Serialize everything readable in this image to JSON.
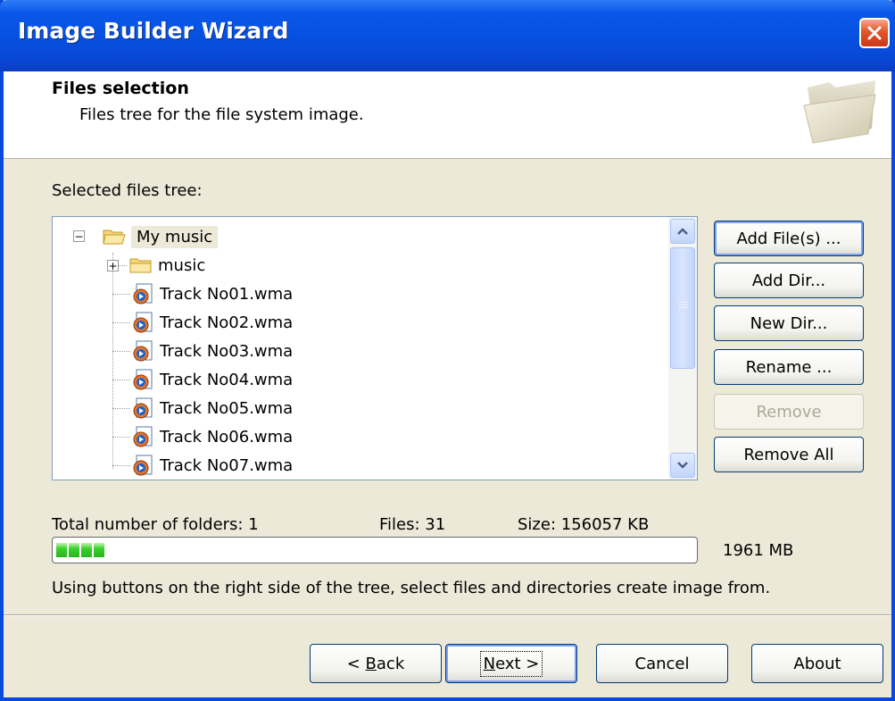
{
  "window": {
    "title": "Image Builder Wizard",
    "close_icon": "close-icon"
  },
  "header": {
    "title": "Files selection",
    "subtitle": "Files tree for the file system image.",
    "icon": "folder-icon"
  },
  "tree": {
    "label": "Selected files tree:",
    "root": {
      "name": "My music",
      "expanded": true
    },
    "items": [
      {
        "name": "music",
        "type": "folder",
        "expanded": false
      },
      {
        "name": "Track No01.wma",
        "type": "file"
      },
      {
        "name": "Track No02.wma",
        "type": "file"
      },
      {
        "name": "Track No03.wma",
        "type": "file"
      },
      {
        "name": "Track No04.wma",
        "type": "file"
      },
      {
        "name": "Track No05.wma",
        "type": "file"
      },
      {
        "name": "Track No06.wma",
        "type": "file"
      },
      {
        "name": "Track No07.wma",
        "type": "file"
      }
    ]
  },
  "side_buttons": {
    "add_files": "Add File(s) ...",
    "add_dir": "Add Dir...",
    "new_dir": "New Dir...",
    "rename": "Rename ...",
    "remove": "Remove",
    "remove_all": "Remove All"
  },
  "stats": {
    "folders": "Total number of folders: 1",
    "files": "Files: 31",
    "size": "Size: 156057 KB",
    "capacity": "1961 MB",
    "progress_fraction": 0.08,
    "progress_color": "#2bb31f"
  },
  "hint": "Using buttons on the right side of the tree, select files and directories create image from.",
  "nav": {
    "back_prefix": "< ",
    "back_accel": "B",
    "back_rest": "ack",
    "next_accel": "N",
    "next_rest": "ext >",
    "cancel": "Cancel",
    "about": "About"
  },
  "colors": {
    "title_bar": "#0a58e8",
    "dialog_bg": "#ece9d8",
    "button_border": "#003c74"
  }
}
